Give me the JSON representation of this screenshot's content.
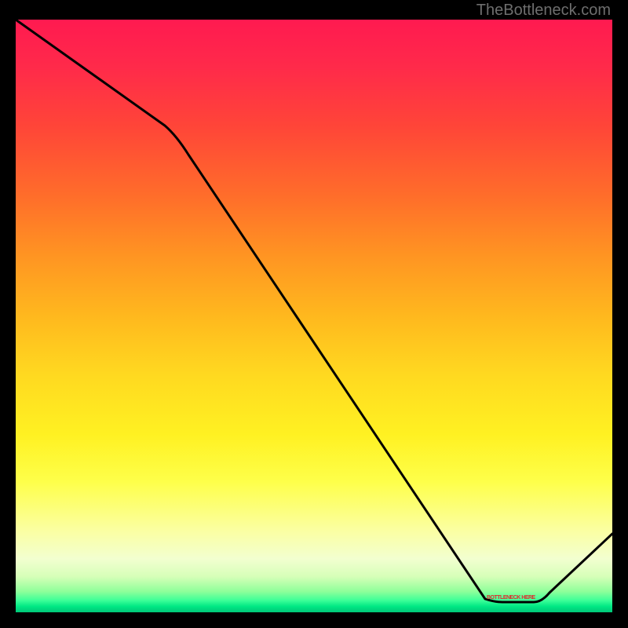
{
  "watermark": "TheBottleneck.com",
  "marker": {
    "label": "BOTTLENECK HERE"
  },
  "chart_data": {
    "type": "line",
    "title": "",
    "xlabel": "",
    "ylabel": "",
    "x_range": [
      0,
      100
    ],
    "y_range": [
      0,
      100
    ],
    "series": [
      {
        "name": "bottleneck-curve",
        "x": [
          0,
          25,
          80,
          87,
          100
        ],
        "values": [
          100,
          82,
          2,
          2,
          13
        ]
      }
    ],
    "gradient_stops": [
      {
        "pos": 0,
        "color": "#ff1a50"
      },
      {
        "pos": 50,
        "color": "#ffd920"
      },
      {
        "pos": 78,
        "color": "#feff4a"
      },
      {
        "pos": 98,
        "color": "#3cff98"
      },
      {
        "pos": 100,
        "color": "#00c878"
      }
    ],
    "annotations": [
      {
        "text": "BOTTLENECK HERE",
        "x": 83,
        "y": 3
      }
    ]
  }
}
